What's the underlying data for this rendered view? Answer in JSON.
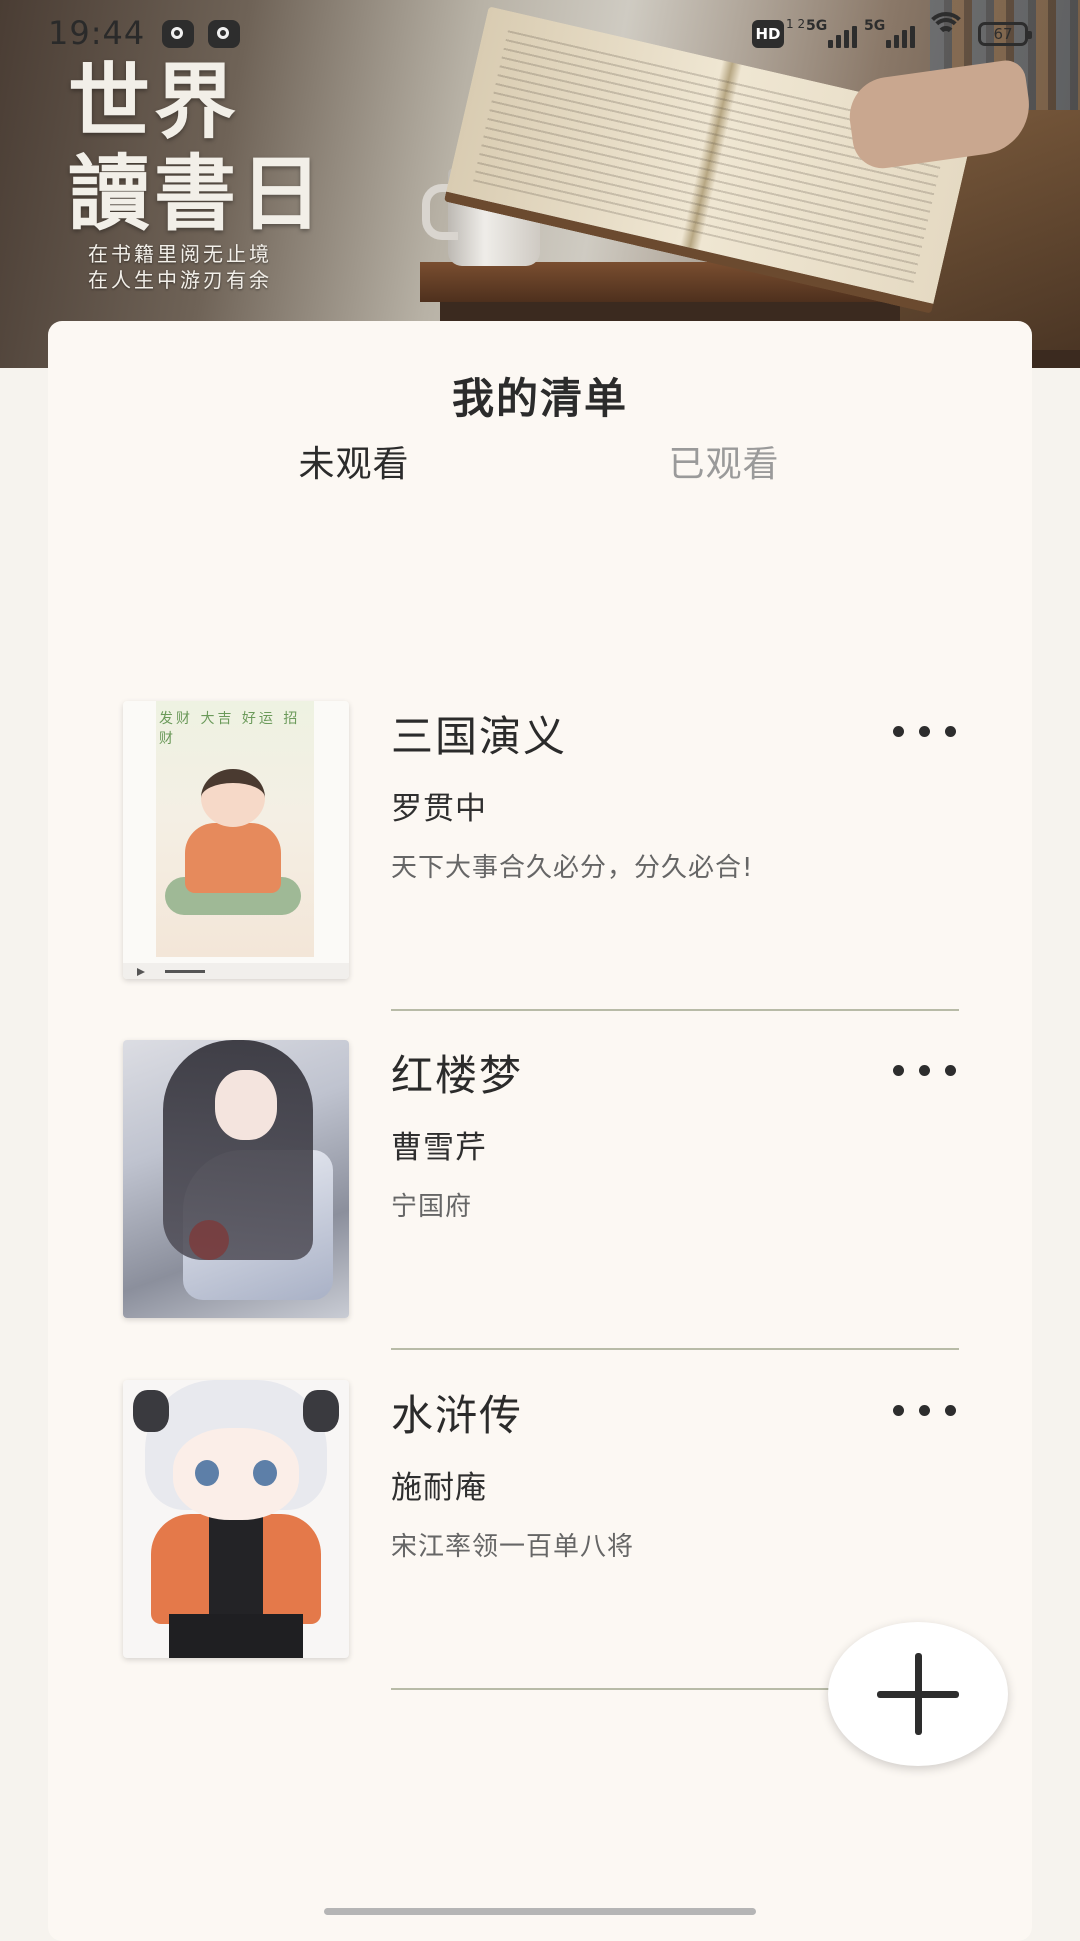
{
  "status_bar": {
    "time": "19:44",
    "hd_label": "HD",
    "hd_sub": "1 2",
    "signal1_label": "5G",
    "signal2_label": "5G",
    "battery": "67"
  },
  "banner": {
    "art_title_line1": "世界",
    "art_title_line2": "讀書日",
    "slogan_line1": "在书籍里阅无止境",
    "slogan_line2": "在人生中游刃有余"
  },
  "page": {
    "title": "我的清单",
    "tabs": [
      {
        "label": "未观看",
        "active": true
      },
      {
        "label": "已观看",
        "active": false
      }
    ]
  },
  "books": [
    {
      "title": "三国演义",
      "author": "罗贯中",
      "description": "天下大事合久必分，分久必合!",
      "cover_text": "发财 大吉 好运 招财"
    },
    {
      "title": "红楼梦",
      "author": "曹雪芹",
      "description": "宁国府"
    },
    {
      "title": "水浒传",
      "author": "施耐庵",
      "description": "宋江率领一百单八将"
    }
  ],
  "icons": {
    "more": "more-horizontal-icon",
    "add": "plus-icon"
  },
  "colors": {
    "card_bg": "#fcf8f3",
    "divider": "#b8bba7",
    "inactive_tab": "#9a9a9a"
  }
}
